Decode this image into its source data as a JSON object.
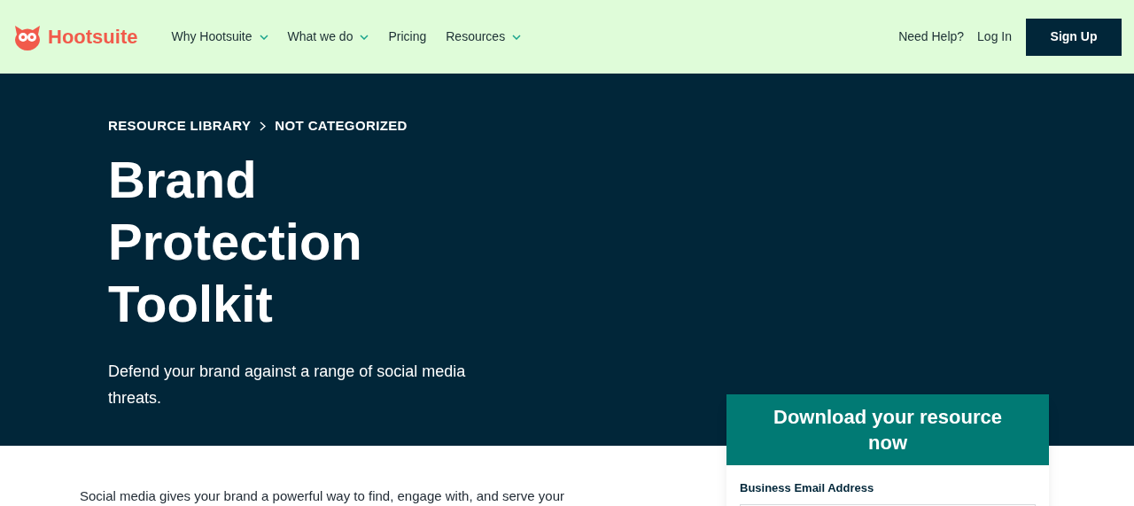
{
  "header": {
    "logo": "Hootsuite",
    "nav": [
      {
        "label": "Why Hootsuite",
        "dropdown": true
      },
      {
        "label": "What we do",
        "dropdown": true
      },
      {
        "label": "Pricing",
        "dropdown": false
      },
      {
        "label": "Resources",
        "dropdown": true
      }
    ],
    "links": [
      "Need Help?",
      "Log In"
    ],
    "cta": "Sign Up"
  },
  "hero": {
    "breadcrumb": [
      "RESOURCE LIBRARY",
      "NOT CATEGORIZED"
    ],
    "title": [
      "Brand",
      "Protection",
      "Toolkit"
    ],
    "subtitle": "Defend your brand against a range of social media threats."
  },
  "form": {
    "heading": "Download your resource now",
    "fields": [
      {
        "label": "Business Email Address"
      }
    ]
  },
  "body": {
    "paragraph": "Social media gives your brand a powerful way to find, engage with, and serve your"
  }
}
